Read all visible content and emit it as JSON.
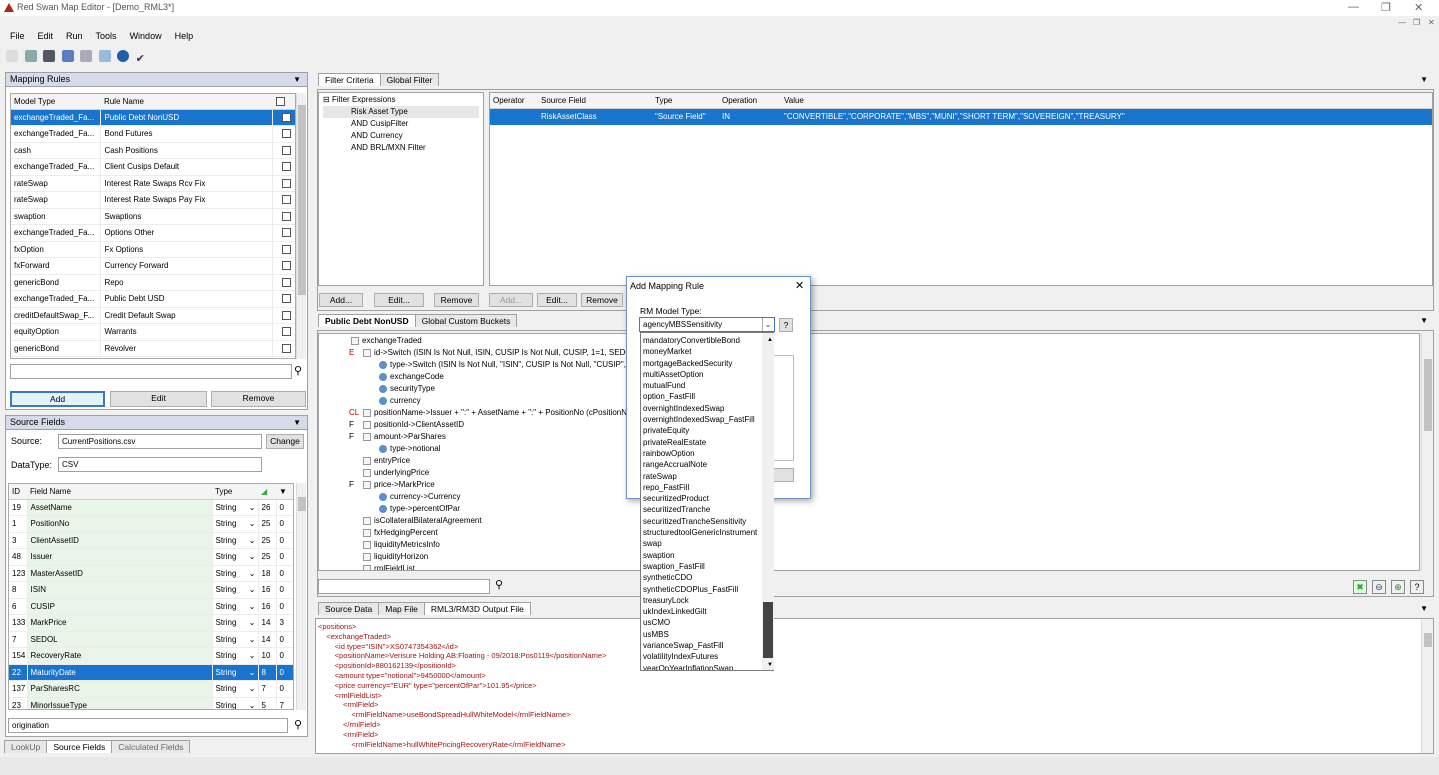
{
  "app": {
    "title": "Red Swan Map Editor - [Demo_RML3*]"
  },
  "menu": [
    "File",
    "Edit",
    "Run",
    "Tools",
    "Window",
    "Help"
  ],
  "mapping_rules": {
    "title": "Mapping Rules",
    "columns": [
      "Model Type",
      "Rule Name"
    ],
    "rows": [
      [
        "exchangeTraded_Fa...",
        "Public Debt NonUSD"
      ],
      [
        "exchangeTraded_Fa...",
        "Bond Futures"
      ],
      [
        "cash",
        "Cash Positions"
      ],
      [
        "exchangeTraded_Fa...",
        "Client Cusips Default"
      ],
      [
        "rateSwap",
        "Interest Rate Swaps Rcv Fix"
      ],
      [
        "rateSwap",
        "Interest Rate Swaps Pay Fix"
      ],
      [
        "swaption",
        "Swaptions"
      ],
      [
        "exchangeTraded_Fa...",
        "Options Other"
      ],
      [
        "fxOption",
        "Fx Options"
      ],
      [
        "fxForward",
        "Currency Forward"
      ],
      [
        "genericBond",
        "Repo"
      ],
      [
        "exchangeTraded_Fa...",
        "Public Debt USD"
      ],
      [
        "creditDefaultSwap_F...",
        "Credit Default Swap"
      ],
      [
        "equityOption",
        "Warrants"
      ],
      [
        "genericBond",
        "Revolver"
      ]
    ],
    "buttons": {
      "add": "Add",
      "edit": "Edit",
      "remove": "Remove"
    }
  },
  "source_fields": {
    "title": "Source Fields",
    "source_label": "Source:",
    "source_value": "CurrentPositions.csv",
    "change": "Change",
    "datatype_label": "DataType:",
    "datatype_value": "CSV",
    "columns": [
      "ID",
      "Field Name",
      "Type"
    ],
    "rows": [
      [
        "19",
        "AssetName",
        "String",
        "26",
        "0"
      ],
      [
        "1",
        "PositionNo",
        "String",
        "25",
        "0"
      ],
      [
        "3",
        "ClientAssetID",
        "String",
        "25",
        "0"
      ],
      [
        "48",
        "Issuer",
        "String",
        "25",
        "0"
      ],
      [
        "123",
        "MasterAssetID",
        "String",
        "18",
        "0"
      ],
      [
        "8",
        "ISIN",
        "String",
        "16",
        "0"
      ],
      [
        "6",
        "CUSIP",
        "String",
        "16",
        "0"
      ],
      [
        "133",
        "MarkPrice",
        "String",
        "14",
        "3"
      ],
      [
        "7",
        "SEDOL",
        "String",
        "14",
        "0"
      ],
      [
        "154",
        "RecoveryRate",
        "String",
        "10",
        "0"
      ],
      [
        "22",
        "MaturityDate",
        "String",
        "8",
        "0"
      ],
      [
        "137",
        "ParSharesRC",
        "String",
        "7",
        "0"
      ],
      [
        "23",
        "MinorIssueType",
        "String",
        "5",
        "7"
      ]
    ],
    "search_value": "origination",
    "bottom_tabs": [
      "LookUp",
      "Source Fields",
      "Calculated Fields"
    ]
  },
  "filter": {
    "tabs": [
      "Filter Criteria",
      "Global Filter"
    ],
    "tree": [
      "Filter Expressions",
      "Risk Asset Type",
      "AND CusipFilter",
      "AND Currency",
      "AND BRL/MXN Filter"
    ],
    "columns": [
      "Operator",
      "Source Field",
      "Type",
      "Operation",
      "Value"
    ],
    "row": [
      "",
      "RiskAssetClass",
      "\"Source Field\"",
      "IN",
      "\"CONVERTIBLE\",\"CORPORATE\",\"MBS\",\"MUNI\",\"SHORT TERM\",\"SOVEREIGN\",\"TREASURY\""
    ],
    "buttons": [
      "Add...",
      "Edit...",
      "Remove",
      "Add...",
      "Edit...",
      "Remove"
    ]
  },
  "mapping": {
    "tabs": [
      "Public Debt NonUSD",
      "Global Custom Buckets"
    ],
    "tree": [
      {
        "p": "",
        "t": "exchangeTraded",
        "d": 0
      },
      {
        "p": "E",
        "t": "id->Switch (ISIN Is Not Null, ISIN, CUSIP Is Not Null, CUSIP, 1=1, SEDOL",
        "d": 1
      },
      {
        "p": "",
        "t": "type->Switch (ISIN Is Not Null, \"ISIN\", CUSIP Is Not Null, \"CUSIP\", 1=",
        "d": 2
      },
      {
        "p": "",
        "t": "exchangeCode",
        "d": 2
      },
      {
        "p": "",
        "t": "securityType",
        "d": 2
      },
      {
        "p": "",
        "t": "currency",
        "d": 2
      },
      {
        "p": "CL",
        "t": "positionName->Issuer + \":\" + AssetName + \":\" + PositionNo  (cPositionNam",
        "d": 1
      },
      {
        "p": "F",
        "t": "positionId->ClientAssetID",
        "d": 1
      },
      {
        "p": "F",
        "t": "amount->ParShares",
        "d": 1
      },
      {
        "p": "",
        "t": "type->notional",
        "d": 2
      },
      {
        "p": "",
        "t": "entryPrice",
        "d": 1
      },
      {
        "p": "",
        "t": "underlyingPrice",
        "d": 1
      },
      {
        "p": "F",
        "t": "price->MarkPrice",
        "d": 1
      },
      {
        "p": "",
        "t": "currency->Currency",
        "d": 2
      },
      {
        "p": "",
        "t": "type->percentOfPar",
        "d": 2
      },
      {
        "p": "",
        "t": "isCollateralBilateralAgreement",
        "d": 1
      },
      {
        "p": "",
        "t": "fxHedgingPercent",
        "d": 1
      },
      {
        "p": "",
        "t": "liquidityMetricsInfo",
        "d": 1
      },
      {
        "p": "",
        "t": "liquidityHorizon",
        "d": 1
      },
      {
        "p": "",
        "t": "rmlFieldList",
        "d": 1
      }
    ]
  },
  "output": {
    "tabs": [
      "Source Data",
      "Map File",
      "RML3/RM3D Output File"
    ],
    "lines": [
      "<positions>",
      "    <exchangeTraded>",
      "        <id type=\"ISIN\">XS0747354362</id>",
      "        <positionName>Verisure Holding AB:Floating - 09/2018:Pos0119</positionName>",
      "        <positionId>880162139</positionId>",
      "        <amount type=\"notional\">9450000</amount>",
      "        <price currency=\"EUR\" type=\"percentOfPar\">101.95</price>",
      "        <rmlFieldList>",
      "            <rmlField>",
      "                <rmlFieldName>useBondSpreadHullWhiteModel</rmlFieldName>",
      "            </rmlField>",
      "            <rmlField>",
      "                <rmlFieldName>hullWhitePricingRecoveryRate</rmlFieldName>"
    ]
  },
  "dialog": {
    "title": "Add Mapping Rule",
    "model_type_label": "RM Model Type:",
    "model_type_value": "agencyMBSSensitivity",
    "help": "?",
    "options": [
      "mandatoryConvertibleBond",
      "moneyMarket",
      "mortgageBackedSecurity",
      "multiAssetOption",
      "mutualFund",
      "option_FastFill",
      "overnightIndexedSwap",
      "overnightIndexedSwap_FastFill",
      "privateEquity",
      "privateRealEstate",
      "rainbowOption",
      "rangeAccrualNote",
      "rateSwap",
      "repo_FastFill",
      "securitizedProduct",
      "securitizedTranche",
      "securitizedTrancheSensitivity",
      "structuredtoolGenericInstrument",
      "swap",
      "swaption",
      "swaption_FastFill",
      "syntheticCDO",
      "syntheticCDOPlus_FastFill",
      "treasuryLock",
      "ukIndexLinkedGilt",
      "usCMO",
      "usMBS",
      "varianceSwap_FastFill",
      "volatilityIndexFutures",
      "yearOnYearInflationSwap"
    ]
  },
  "colors": {
    "selection": "#1874cd",
    "panel_header": "#d6dbe9"
  }
}
